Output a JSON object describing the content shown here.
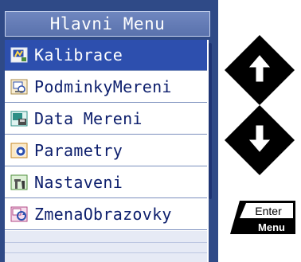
{
  "menu": {
    "title": "Hlavni Menu",
    "items": [
      {
        "label": "Kalibrace",
        "icon": "calibration-icon",
        "selected": true
      },
      {
        "label": "PodminkyMereni",
        "icon": "conditions-icon",
        "selected": false
      },
      {
        "label": "Data Mereni",
        "icon": "data-icon",
        "selected": false
      },
      {
        "label": "Parametry",
        "icon": "parameters-icon",
        "selected": false
      },
      {
        "label": "Nastaveni",
        "icon": "settings-icon",
        "selected": false
      },
      {
        "label": "ZmenaObrazovky",
        "icon": "screen-change-icon",
        "selected": false
      }
    ]
  },
  "keys": {
    "up": "up-arrow-key",
    "down": "down-arrow-key",
    "enter_top": "Enter",
    "enter_bottom": "Menu"
  },
  "colors": {
    "panel": "#2f4a87",
    "selected": "#2d4fae",
    "text": "#0c1e6c"
  }
}
